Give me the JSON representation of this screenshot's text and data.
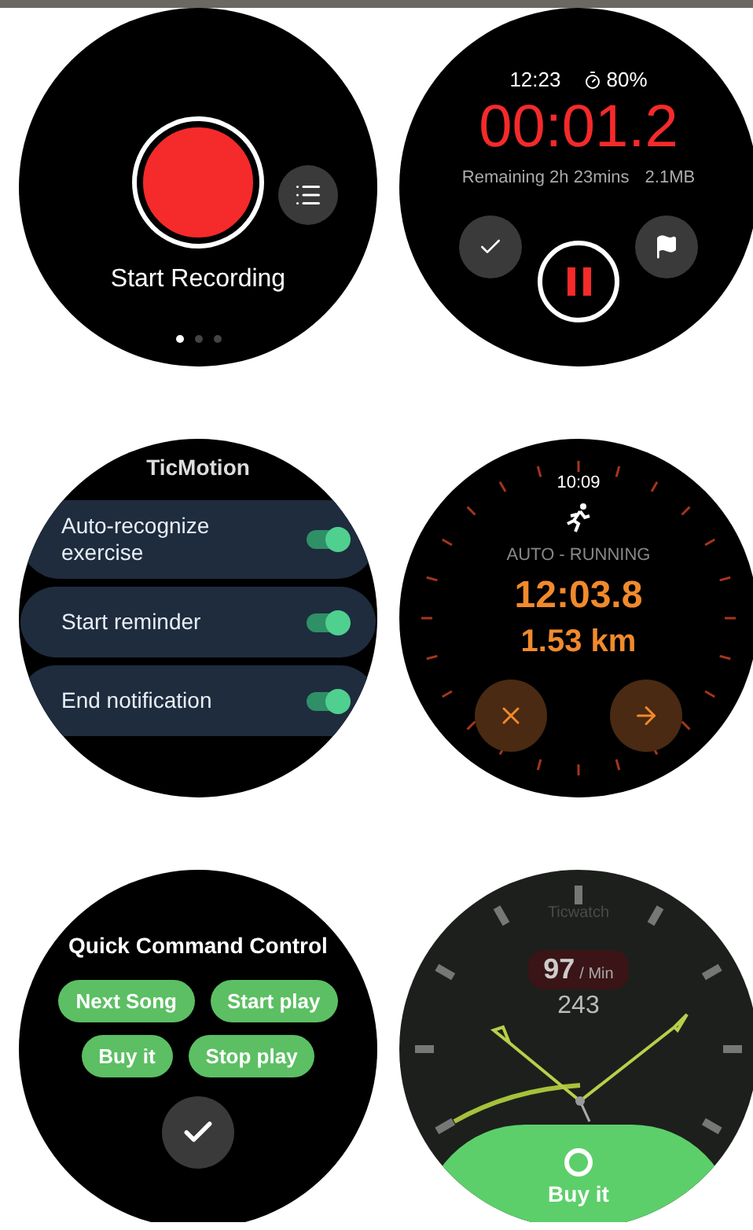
{
  "screens": [
    {
      "kind": "recorder_start",
      "label": "Start Recording",
      "page_dots": [
        {
          "selected": true
        },
        {
          "selected": false
        },
        {
          "selected": false
        }
      ]
    },
    {
      "kind": "recording",
      "time": "12:23",
      "battery": "80%",
      "elapsed": "00:01.2",
      "remaining": "Remaining 2h 23mins",
      "size": "2.1MB"
    },
    {
      "kind": "settings",
      "title": "TicMotion",
      "items": [
        {
          "label": "Auto-recognize exercise",
          "on": true
        },
        {
          "label": "Start reminder",
          "on": true
        },
        {
          "label": "End notification",
          "on": true
        }
      ]
    },
    {
      "kind": "workout",
      "time": "10:09",
      "mode": "AUTO - RUNNING",
      "duration": "12:03.8",
      "distance": "1.53 km"
    },
    {
      "kind": "commands",
      "title": "Quick Command Control",
      "commands": [
        "Next Song",
        "Start play",
        "Buy it",
        "Stop play"
      ]
    },
    {
      "kind": "watchface",
      "brand": "Ticwatch",
      "heart_rate": "97",
      "heart_rate_unit": "/ Min",
      "calories": "243",
      "action": "Buy it"
    }
  ]
}
